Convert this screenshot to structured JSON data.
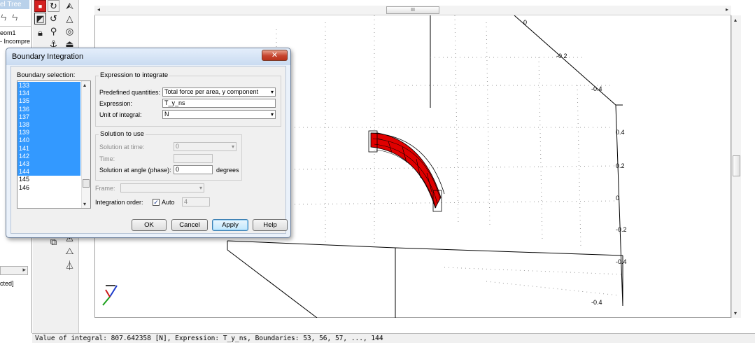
{
  "model_tree": {
    "tab_label": "el Tree",
    "toolbar_glyphs": "ㄣ ㄣ",
    "items": [
      "eom1",
      "- Incompre"
    ],
    "status_fragment": "cted]"
  },
  "graphics": {
    "hscroll_thumb_label": "III",
    "axis_ticks": [
      {
        "label": "0"
      },
      {
        "label": "-0.2"
      },
      {
        "label": "-0.4"
      },
      {
        "label": "0.4"
      },
      {
        "label": "0.2"
      },
      {
        "label": "0"
      },
      {
        "label": "-0.2"
      },
      {
        "label": "-0.4"
      },
      {
        "label": "-0.4"
      }
    ]
  },
  "status_bar": {
    "text": "Value of integral: 807.642358 [N], Expression: T_y_ns, Boundaries: 53, 56, 57, ..., 144"
  },
  "dialog": {
    "title": "Boundary Integration",
    "close_glyph": "✕",
    "boundary_selection_label": "Boundary selection:",
    "boundaries": [
      {
        "id": "133",
        "selected": true
      },
      {
        "id": "134",
        "selected": true
      },
      {
        "id": "135",
        "selected": true
      },
      {
        "id": "136",
        "selected": true
      },
      {
        "id": "137",
        "selected": true
      },
      {
        "id": "138",
        "selected": true
      },
      {
        "id": "139",
        "selected": true
      },
      {
        "id": "140",
        "selected": true
      },
      {
        "id": "141",
        "selected": true
      },
      {
        "id": "142",
        "selected": true
      },
      {
        "id": "143",
        "selected": true
      },
      {
        "id": "144",
        "selected": true
      },
      {
        "id": "145",
        "selected": false
      },
      {
        "id": "146",
        "selected": false
      }
    ],
    "expression_group": {
      "legend": "Expression to integrate",
      "predefined_label": "Predefined quantities:",
      "predefined_value": "Total force per area, y component",
      "expression_label": "Expression:",
      "expression_value": "T_y_ns",
      "unit_label": "Unit of integral:",
      "unit_value": "N"
    },
    "solution_group": {
      "legend": "Solution to use",
      "time_sol_label": "Solution at time:",
      "time_sol_value": "0",
      "time_label": "Time:",
      "time_value": "",
      "angle_label": "Solution at angle (phase):",
      "angle_value": "0",
      "angle_unit": "degrees"
    },
    "frame_label": "Frame:",
    "frame_value": "",
    "integration_order_label": "Integration order:",
    "auto_label": "Auto",
    "auto_checked": true,
    "order_value": "4",
    "buttons": {
      "ok": "OK",
      "cancel": "Cancel",
      "apply": "Apply",
      "help": "Help"
    }
  },
  "colors": {
    "selection": "#3399ff",
    "geometry_highlight": "#e00000",
    "close_button": "#c64530"
  }
}
